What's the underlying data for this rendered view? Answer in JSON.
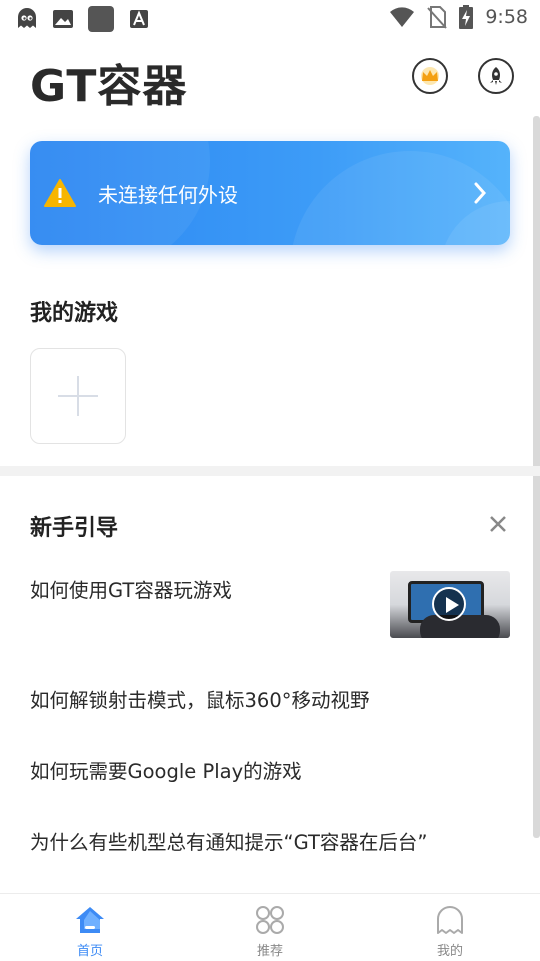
{
  "status_bar": {
    "time": "9:58",
    "left_icons": [
      "ghost-icon",
      "image-icon",
      "square-icon",
      "font-icon"
    ],
    "right_icons": [
      "wifi-icon",
      "no-sim-icon",
      "battery-charging-icon"
    ]
  },
  "header": {
    "title": "GT容器",
    "crown_button": "crown-icon",
    "rocket_button": "rocket-icon"
  },
  "banner": {
    "text": "未连接任何外设",
    "icon": "warning-icon",
    "accent": "#2b86f2"
  },
  "my_games": {
    "title": "我的游戏",
    "add_icon": "plus-icon"
  },
  "guide": {
    "title": "新手引导",
    "items": [
      "如何使用GT容器玩游戏",
      "如何解锁射击模式，鼠标360°移动视野",
      "如何玩需要Google Play的游戏",
      "为什么有些机型总有通知提示“GT容器在后台”"
    ]
  },
  "bottom_nav": {
    "active_color": "#3d8bf5",
    "items": [
      {
        "label": "首页",
        "icon": "home-icon"
      },
      {
        "label": "推荐",
        "icon": "grid-icon"
      },
      {
        "label": "我的",
        "icon": "ghost-profile-icon"
      }
    ]
  }
}
